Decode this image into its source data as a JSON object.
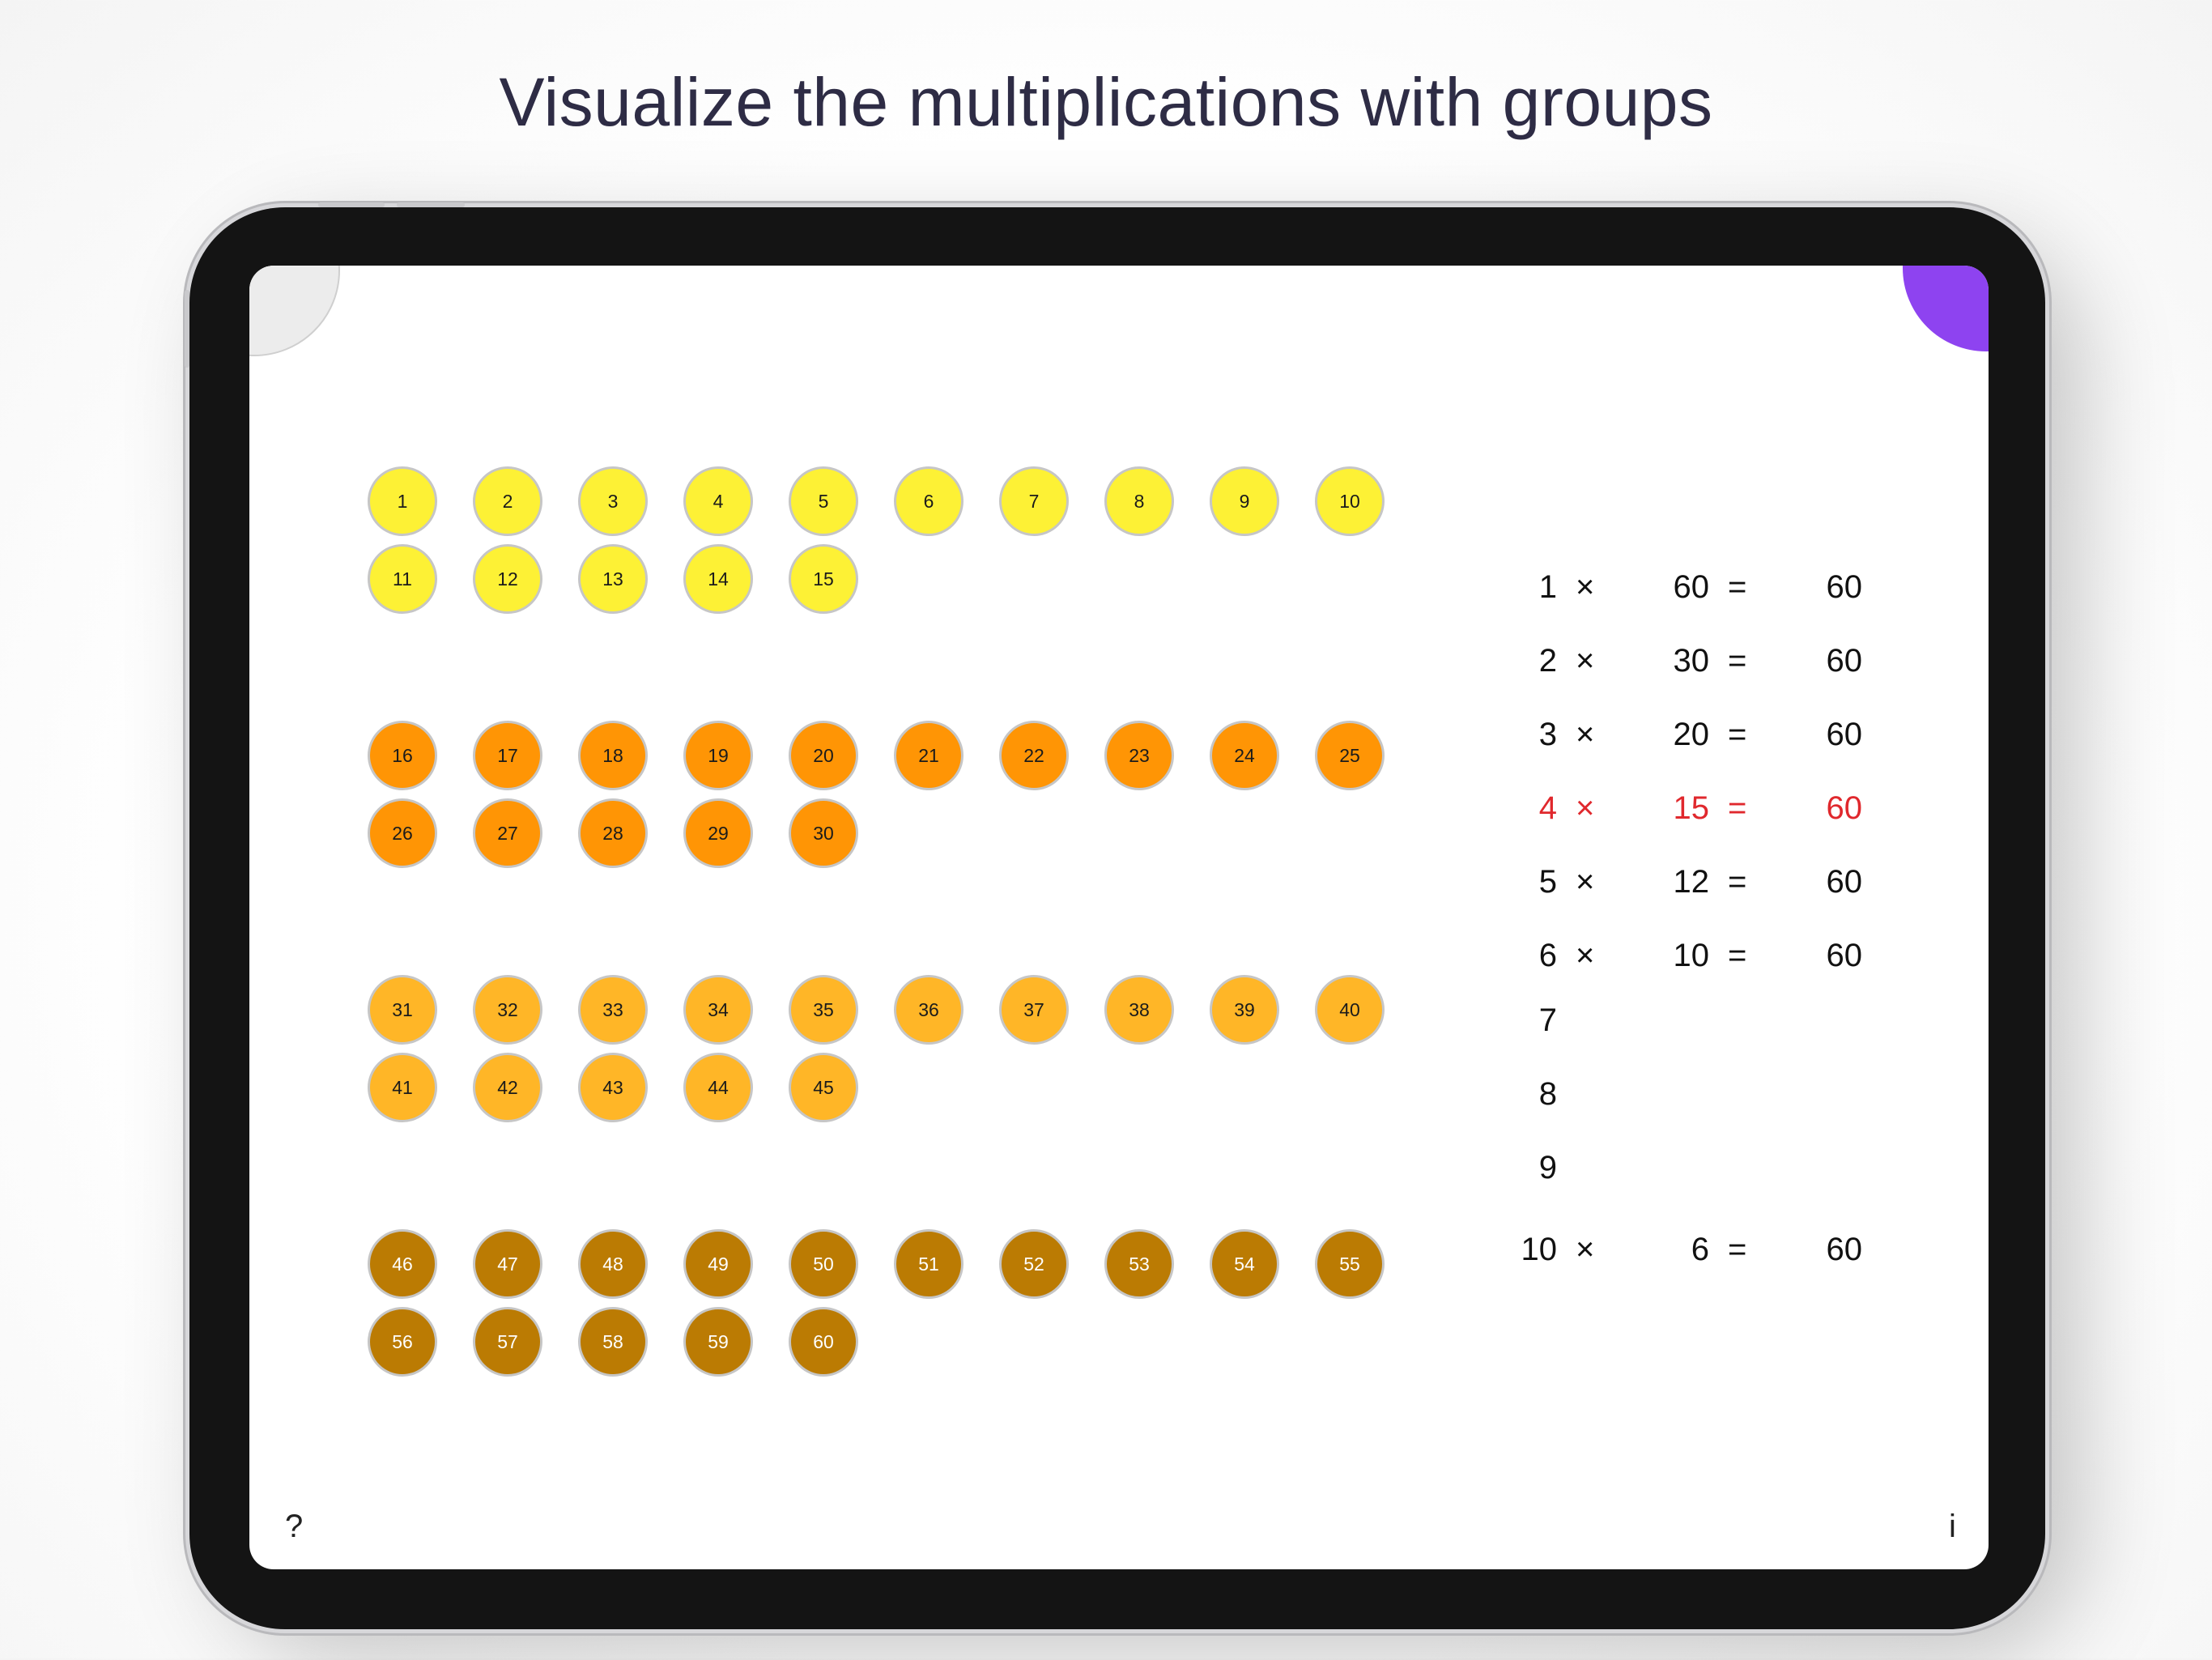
{
  "headline": "Visualize the multiplications with groups",
  "colors": {
    "group_colors": [
      "#fdf135",
      "#ff9505",
      "#ffb627",
      "#bb7b03"
    ],
    "group_text_colors": [
      "#1b1b1b",
      "#1b1b1b",
      "#1b1b1b",
      "#ffffff"
    ],
    "highlight": "#e0282d",
    "corner_accent": "#8e43f0"
  },
  "groups": [
    {
      "numbers": [
        "1",
        "2",
        "3",
        "4",
        "5",
        "6",
        "7",
        "8",
        "9",
        "10",
        "11",
        "12",
        "13",
        "14",
        "15"
      ]
    },
    {
      "numbers": [
        "16",
        "17",
        "18",
        "19",
        "20",
        "21",
        "22",
        "23",
        "24",
        "25",
        "26",
        "27",
        "28",
        "29",
        "30"
      ]
    },
    {
      "numbers": [
        "31",
        "32",
        "33",
        "34",
        "35",
        "36",
        "37",
        "38",
        "39",
        "40",
        "41",
        "42",
        "43",
        "44",
        "45"
      ]
    },
    {
      "numbers": [
        "46",
        "47",
        "48",
        "49",
        "50",
        "51",
        "52",
        "53",
        "54",
        "55",
        "56",
        "57",
        "58",
        "59",
        "60"
      ]
    }
  ],
  "equations": [
    {
      "a": "1",
      "op": "×",
      "b": "60",
      "eq": "=",
      "result": "60",
      "highlight": false
    },
    {
      "a": "2",
      "op": "×",
      "b": "30",
      "eq": "=",
      "result": "60",
      "highlight": false
    },
    {
      "a": "3",
      "op": "×",
      "b": "20",
      "eq": "=",
      "result": "60",
      "highlight": false
    },
    {
      "a": "4",
      "op": "×",
      "b": "15",
      "eq": "=",
      "result": "60",
      "highlight": true
    },
    {
      "a": "5",
      "op": "×",
      "b": "12",
      "eq": "=",
      "result": "60",
      "highlight": false
    },
    {
      "a": "6",
      "op": "×",
      "b": "10",
      "eq": "=",
      "result": "60",
      "highlight": false
    },
    {
      "a": "7",
      "op": "",
      "b": "",
      "eq": "",
      "result": "",
      "highlight": false
    },
    {
      "a": "8",
      "op": "",
      "b": "",
      "eq": "",
      "result": "",
      "highlight": false
    },
    {
      "a": "9",
      "op": "",
      "b": "",
      "eq": "",
      "result": "",
      "highlight": false
    },
    {
      "a": "10",
      "op": "×",
      "b": "6",
      "eq": "=",
      "result": "60",
      "highlight": false
    }
  ],
  "help_button": "?",
  "info_button": "i"
}
